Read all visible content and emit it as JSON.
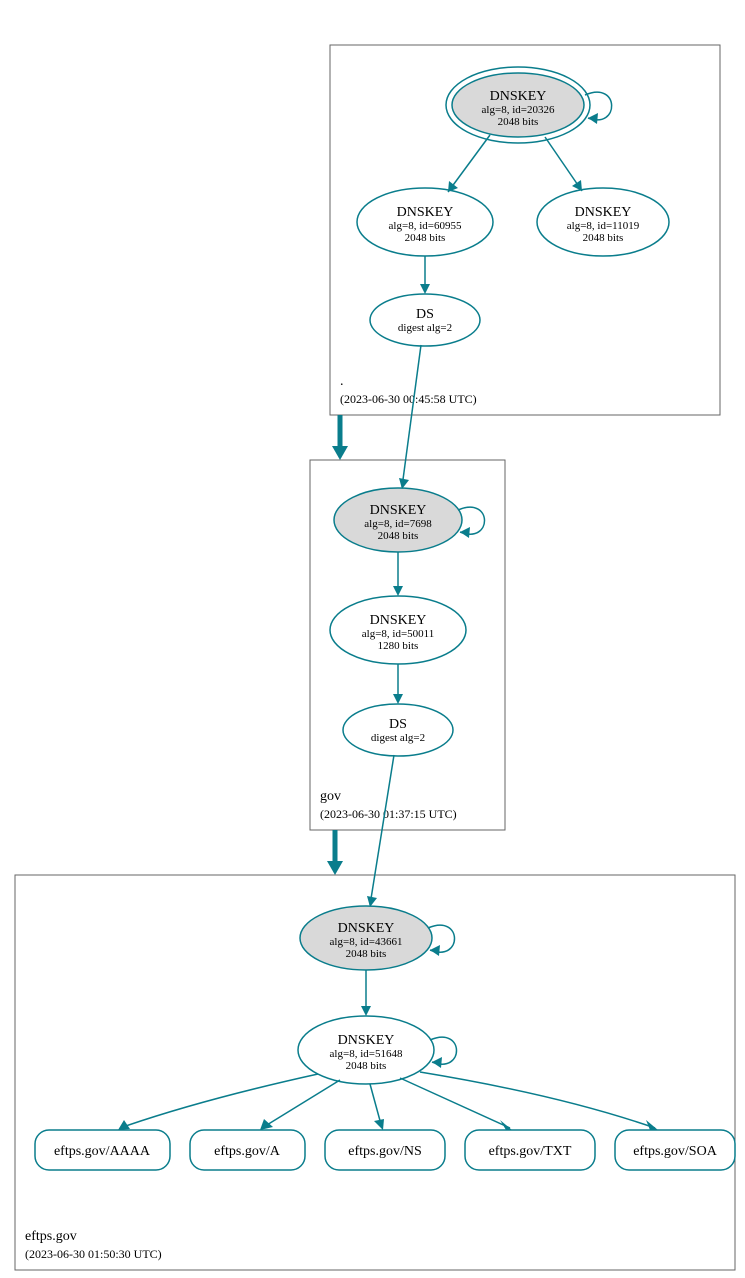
{
  "zones": {
    "root": {
      "label": ".",
      "timestamp": "(2023-06-30 00:45:58 UTC)",
      "nodes": {
        "ksk": {
          "title": "DNSKEY",
          "line2": "alg=8, id=20326",
          "line3": "2048 bits"
        },
        "zsk1": {
          "title": "DNSKEY",
          "line2": "alg=8, id=60955",
          "line3": "2048 bits"
        },
        "zsk2": {
          "title": "DNSKEY",
          "line2": "alg=8, id=11019",
          "line3": "2048 bits"
        },
        "ds": {
          "title": "DS",
          "line2": "digest alg=2"
        }
      }
    },
    "gov": {
      "label": "gov",
      "timestamp": "(2023-06-30 01:37:15 UTC)",
      "nodes": {
        "ksk": {
          "title": "DNSKEY",
          "line2": "alg=8, id=7698",
          "line3": "2048 bits"
        },
        "zsk": {
          "title": "DNSKEY",
          "line2": "alg=8, id=50011",
          "line3": "1280 bits"
        },
        "ds": {
          "title": "DS",
          "line2": "digest alg=2"
        }
      }
    },
    "eftps": {
      "label": "eftps.gov",
      "timestamp": "(2023-06-30 01:50:30 UTC)",
      "nodes": {
        "ksk": {
          "title": "DNSKEY",
          "line2": "alg=8, id=43661",
          "line3": "2048 bits"
        },
        "zsk": {
          "title": "DNSKEY",
          "line2": "alg=8, id=51648",
          "line3": "2048 bits"
        }
      },
      "records": {
        "aaaa": "eftps.gov/AAAA",
        "a": "eftps.gov/A",
        "ns": "eftps.gov/NS",
        "txt": "eftps.gov/TXT",
        "soa": "eftps.gov/SOA"
      }
    }
  }
}
